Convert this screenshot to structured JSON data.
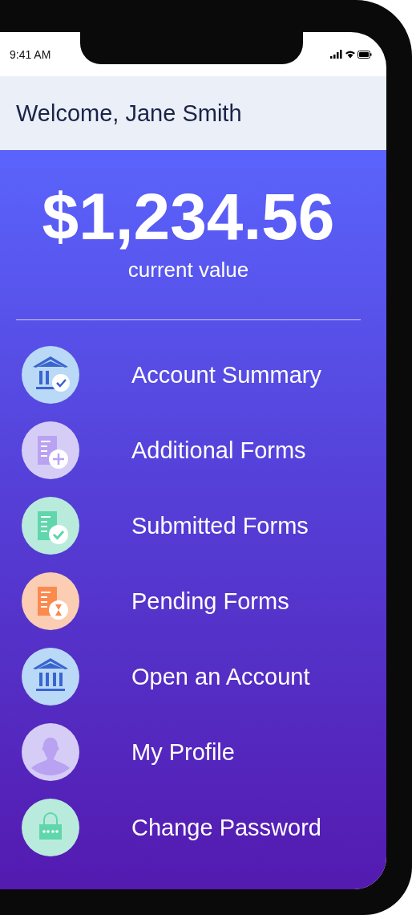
{
  "status_bar": {
    "time": "9:41 AM"
  },
  "header": {
    "title": "Welcome, Jane Smith"
  },
  "balance": {
    "amount": "$1,234.56",
    "caption": "current value"
  },
  "menu": [
    {
      "label": "Account Summary",
      "kind": "bank-check",
      "color": "#b9d9f7"
    },
    {
      "label": "Additional Forms",
      "kind": "form-plus",
      "color": "#d6cdf7"
    },
    {
      "label": "Submitted Forms",
      "kind": "form-check",
      "color": "#b9ebdc"
    },
    {
      "label": "Pending Forms",
      "kind": "form-hourglass",
      "color": "#fbcdb3"
    },
    {
      "label": "Open an Account",
      "kind": "bank",
      "color": "#b9d9f7"
    },
    {
      "label": "My Profile",
      "kind": "person",
      "color": "#d6cdf7"
    },
    {
      "label": "Change Password",
      "kind": "lock",
      "color": "#b9ebdc"
    }
  ]
}
